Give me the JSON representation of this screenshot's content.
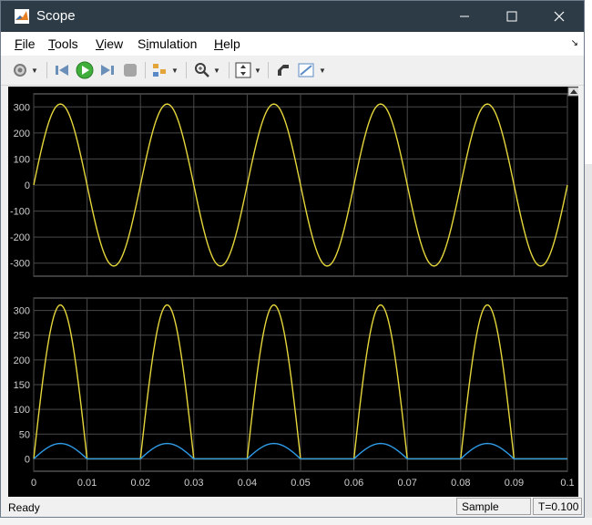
{
  "window": {
    "title": "Scope"
  },
  "menu": {
    "file": "File",
    "tools": "Tools",
    "view": "View",
    "simulation": "Simulation",
    "help": "Help"
  },
  "toolbar": {
    "icons": [
      "settings-icon",
      "step-back-icon",
      "run-icon",
      "step-forward-icon",
      "stop-icon",
      "signal-select-icon",
      "zoom-icon",
      "autoscale-icon",
      "highlight-icon",
      "measure-icon"
    ]
  },
  "colors": {
    "signal_yellow": "#e5d63b",
    "signal_blue": "#2f9ae5",
    "plot_bg": "#000000",
    "grid": "#4a4a4a",
    "axes_text": "#cfcfcf"
  },
  "chart_data": [
    {
      "type": "line",
      "x_range": [
        0,
        0.1
      ],
      "ylim": [
        -350,
        350
      ],
      "y_ticks": [
        -300,
        -200,
        -100,
        0,
        100,
        200,
        300
      ],
      "x_ticks": [
        0,
        0.01,
        0.02,
        0.03,
        0.04,
        0.05,
        0.06,
        0.07,
        0.08,
        0.09,
        0.1
      ],
      "grid": true,
      "series": [
        {
          "color": "#e5d63b",
          "shape": "sine",
          "amplitude": 311,
          "frequency_hz": 50
        }
      ]
    },
    {
      "type": "line",
      "x_range": [
        0,
        0.1
      ],
      "ylim": [
        -25,
        325
      ],
      "y_ticks": [
        0,
        50,
        100,
        150,
        200,
        250,
        300
      ],
      "x_ticks": [
        0,
        0.01,
        0.02,
        0.03,
        0.04,
        0.05,
        0.06,
        0.07,
        0.08,
        0.09,
        0.1
      ],
      "x_tick_labels": [
        "0",
        "0.01",
        "0.02",
        "0.03",
        "0.04",
        "0.05",
        "0.06",
        "0.07",
        "0.08",
        "0.09",
        "0.1"
      ],
      "grid": true,
      "series": [
        {
          "color": "#e5d63b",
          "shape": "half-wave rectified sine",
          "amplitude": 311,
          "frequency_hz": 50
        },
        {
          "color": "#2f9ae5",
          "shape": "half-wave rectified sine",
          "amplitude": 31,
          "frequency_hz": 50
        }
      ]
    }
  ],
  "status": {
    "ready": "Ready",
    "sample_mode": "Sample based",
    "time": "T=0.100"
  }
}
